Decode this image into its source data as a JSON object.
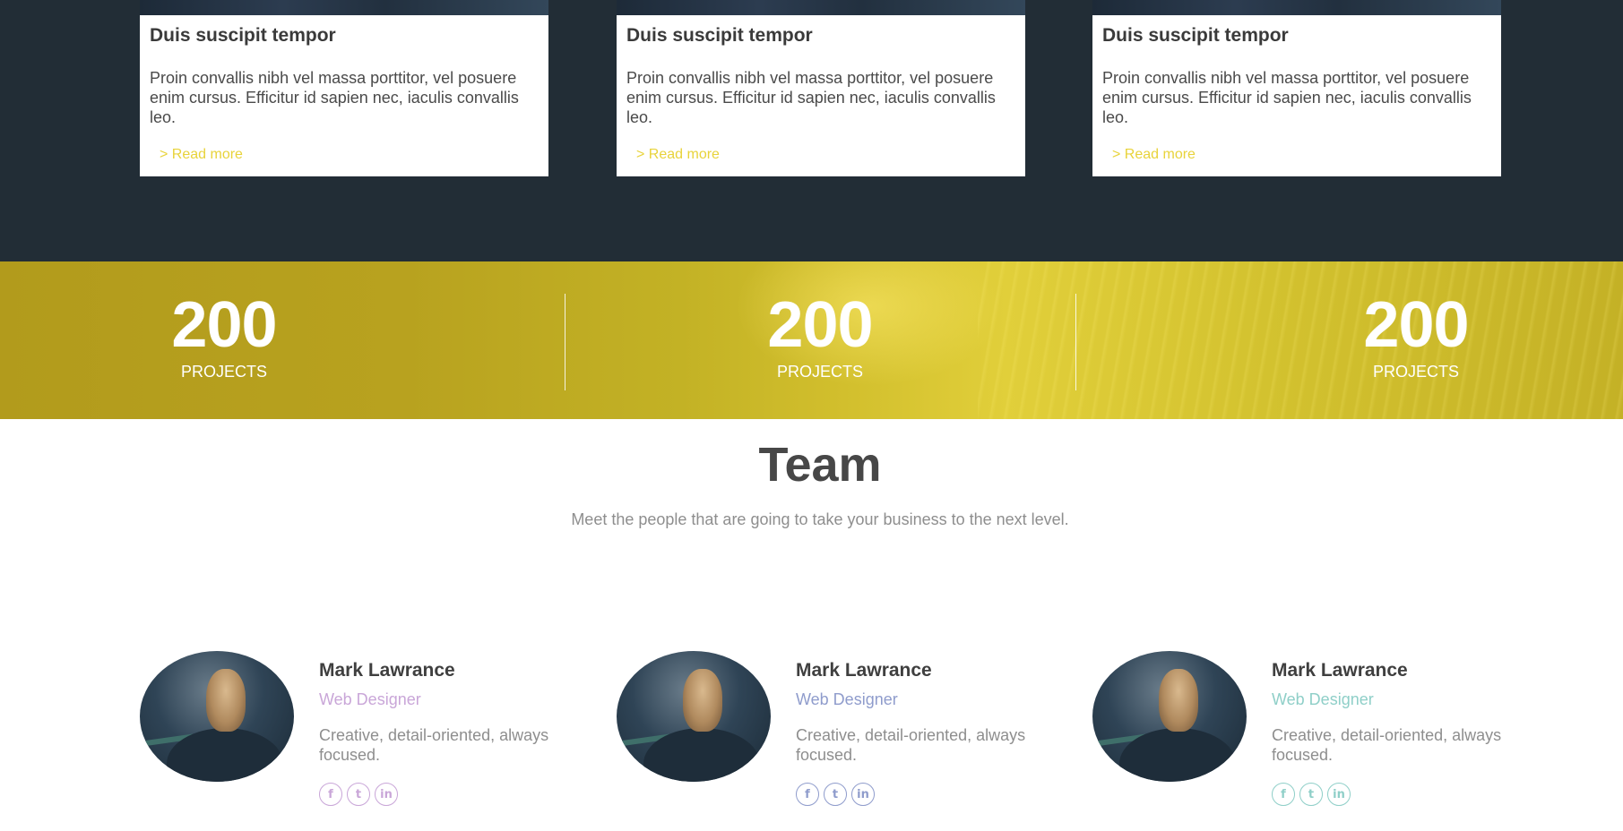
{
  "blog": {
    "cards": [
      {
        "title": "Duis suscipit tempor",
        "text": "Proin convallis nibh vel massa porttitor, vel posuere enim cursus. Efficitur id sapien nec, iaculis convallis leo.",
        "link": "> Read more"
      },
      {
        "title": "Duis suscipit tempor",
        "text": "Proin convallis nibh vel massa porttitor, vel posuere enim cursus. Efficitur id sapien nec, iaculis convallis leo.",
        "link": "> Read more"
      },
      {
        "title": "Duis suscipit tempor",
        "text": "Proin convallis nibh vel massa porttitor, vel posuere enim cursus. Efficitur id sapien nec, iaculis convallis leo.",
        "link": "> Read more"
      }
    ],
    "link_color": "#e8d33a"
  },
  "stats": [
    {
      "number": "200",
      "label": "PROJECTS"
    },
    {
      "number": "200",
      "label": "PROJECTS"
    },
    {
      "number": "200",
      "label": "PROJECTS"
    }
  ],
  "team": {
    "title": "Team",
    "subtitle": "Meet the people that are going to take your business to the next level.",
    "members": [
      {
        "name": "Mark Lawrance",
        "role": "Web Designer",
        "bio": "Creative, detail-oriented, always focused.",
        "accent": "#c9a6d8",
        "social": [
          {
            "icon": "facebook-icon",
            "glyph": "f"
          },
          {
            "icon": "twitter-icon",
            "glyph": "t"
          },
          {
            "icon": "linkedin-icon",
            "glyph": "in"
          }
        ]
      },
      {
        "name": "Mark Lawrance",
        "role": "Web Designer",
        "bio": "Creative, detail-oriented, always focused.",
        "accent": "#8f9ccc",
        "social": [
          {
            "icon": "facebook-icon",
            "glyph": "f"
          },
          {
            "icon": "twitter-icon",
            "glyph": "t"
          },
          {
            "icon": "linkedin-icon",
            "glyph": "in"
          }
        ]
      },
      {
        "name": "Mark Lawrance",
        "role": "Web Designer",
        "bio": "Creative, detail-oriented, always focused.",
        "accent": "#8fcfc8",
        "social": [
          {
            "icon": "facebook-icon",
            "glyph": "f"
          },
          {
            "icon": "twitter-icon",
            "glyph": "t"
          },
          {
            "icon": "linkedin-icon",
            "glyph": "in"
          }
        ]
      }
    ]
  }
}
